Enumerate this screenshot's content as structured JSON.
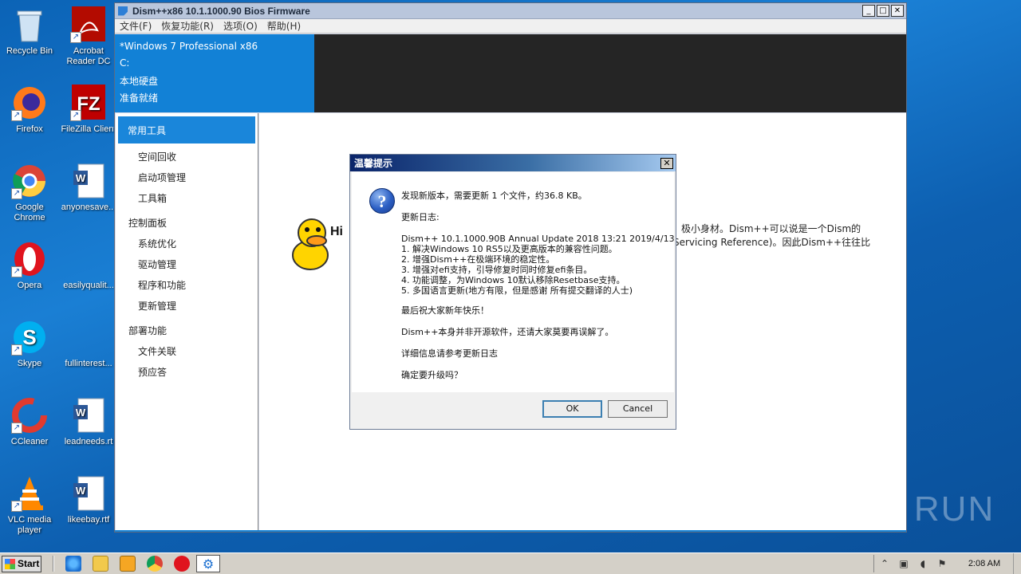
{
  "desktop": {
    "icons": [
      {
        "label": "Recycle Bin"
      },
      {
        "label": "Acrobat Reader DC"
      },
      {
        "label": "Firefox"
      },
      {
        "label": "FileZilla Client"
      },
      {
        "label": "Google Chrome"
      },
      {
        "label": "anyonesave..."
      },
      {
        "label": "Opera"
      },
      {
        "label": "easilyqualit..."
      },
      {
        "label": "Skype"
      },
      {
        "label": "fullinterest..."
      },
      {
        "label": "CCleaner"
      },
      {
        "label": "leadneeds.rt"
      },
      {
        "label": "VLC media player"
      },
      {
        "label": "likeebay.rtf"
      }
    ]
  },
  "window": {
    "title": "Dism++x86 10.1.1000.90 Bios Firmware",
    "menu": [
      "文件(F)",
      "恢复功能(R)",
      "选项(O)",
      "帮助(H)"
    ],
    "header": {
      "os": "*Windows 7 Professional x86",
      "drive": "C:",
      "disk": "本地硬盘",
      "status": "准备就绪"
    },
    "sidebar": {
      "selected": "常用工具",
      "groups": [
        {
          "title": "",
          "items": [
            "空间回收",
            "启动项管理",
            "工具箱"
          ]
        },
        {
          "title": "控制面板",
          "items": [
            "系统优化",
            "驱动管理",
            "程序和功能",
            "更新管理"
          ]
        },
        {
          "title": "部署功能",
          "items": [
            "文件关联",
            "预应答"
          ]
        }
      ]
    },
    "content": {
      "hi": "Hi",
      "intro_line1": "极小身材。Dism++可以说是一个Dism的",
      "intro_line2": "Servicing Reference)。因此Dism++往往比"
    }
  },
  "dialog": {
    "title": "温馨提示",
    "close": "✕",
    "line1": "发现新版本，需要更新 1 个文件，约36.8 KB。",
    "log_title": "更新日志:",
    "log": [
      "Dism++ 10.1.1000.90B Annual Update 2018 13:21 2019/4/13",
      "1. 解决Windows 10 RS5以及更高版本的兼容性问题。",
      "2. 增强Dism++在极端环境的稳定性。",
      "3. 增强对efi支持，引导修复时同时修复efi条目。",
      "4. 功能调整，为Windows 10默认移除Resetbase支持。",
      "5. 多国语言更新(地方有限，但是感谢 所有提交翻译的人士)"
    ],
    "greeting": "最后祝大家新年快乐！",
    "note": "Dism++本身并非开源软件，还请大家莫要再误解了。",
    "details": "详细信息请参考更新日志",
    "confirm": "确定要升级吗？",
    "ok": "OK",
    "cancel": "Cancel"
  },
  "watermark": "ANY RUN",
  "taskbar": {
    "start": "Start",
    "clock": "2:08 AM"
  },
  "colors": {
    "accent": "#1281d6",
    "desktop": "#0b63b6"
  }
}
